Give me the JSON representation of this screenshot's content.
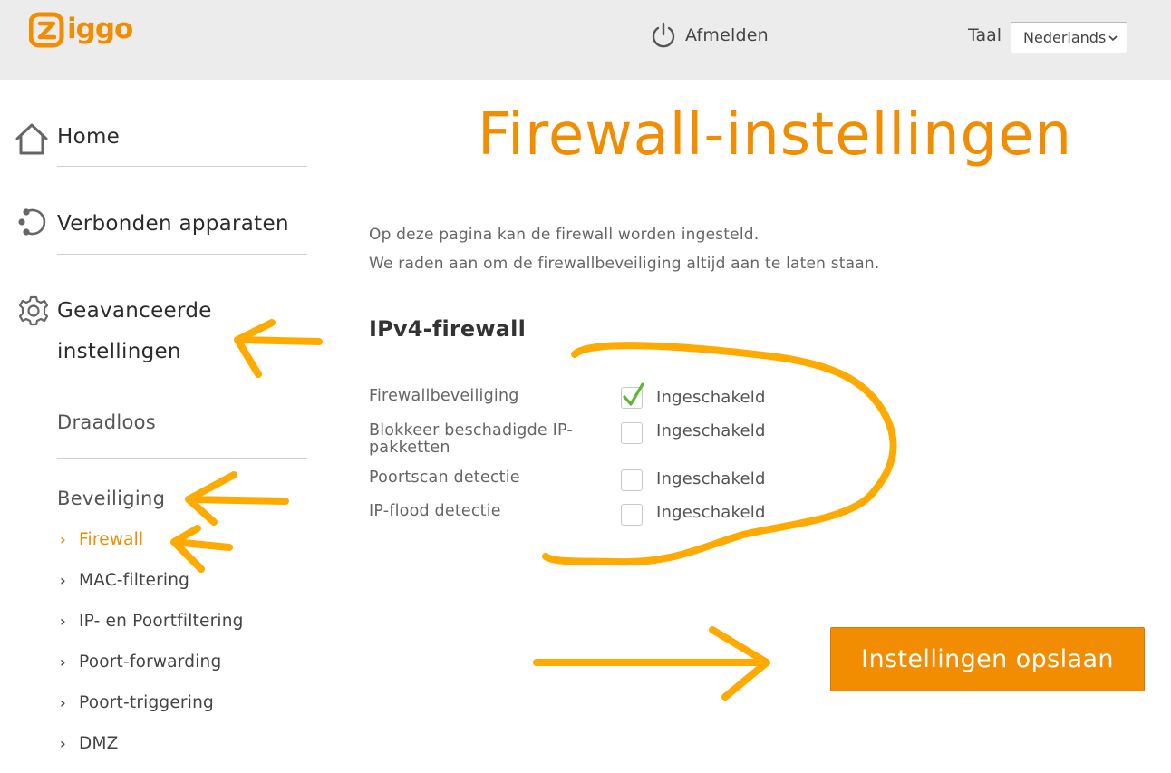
{
  "header": {
    "logo_text": "ziggo",
    "logout_label": "Afmelden",
    "language_label": "Taal",
    "language_selected": "Nederlands"
  },
  "sidebar": {
    "items": [
      {
        "label": "Home",
        "icon": "home-icon"
      },
      {
        "label": "Verbonden apparaten",
        "icon": "connected-devices-icon"
      },
      {
        "label_line1": "Geavanceerde",
        "label_line2": "instellingen",
        "icon": "gear-icon"
      }
    ],
    "sections": [
      {
        "label": "Draadloos"
      },
      {
        "label": "Beveiliging"
      }
    ],
    "security_items": [
      {
        "label": "Firewall",
        "active": true
      },
      {
        "label": "MAC-filtering"
      },
      {
        "label": "IP- en Poortfiltering"
      },
      {
        "label": "Poort-forwarding"
      },
      {
        "label": "Poort-triggering"
      },
      {
        "label": "DMZ"
      }
    ]
  },
  "main": {
    "title": "Firewall-instellingen",
    "intro_line1": "Op deze pagina kan de firewall worden ingesteld.",
    "intro_line2": "We raden aan om de firewallbeveiliging altijd aan te laten staan.",
    "section_title": "IPv4-firewall",
    "settings": [
      {
        "label": "Firewallbeveiliging",
        "checked": true,
        "value_label": "Ingeschakeld"
      },
      {
        "label": "Blokkeer beschadigde IP-pakketten",
        "checked": false,
        "value_label": "Ingeschakeld"
      },
      {
        "label": "Poortscan detectie",
        "checked": false,
        "value_label": "Ingeschakeld"
      },
      {
        "label": "IP-flood detectie",
        "checked": false,
        "value_label": "Ingeschakeld"
      }
    ],
    "save_button": "Instellingen opslaan"
  },
  "colors": {
    "brand_orange": "#f28c00",
    "annotation_orange": "#ffaa00",
    "check_green": "#5cb82e",
    "header_bg": "#ececec"
  }
}
